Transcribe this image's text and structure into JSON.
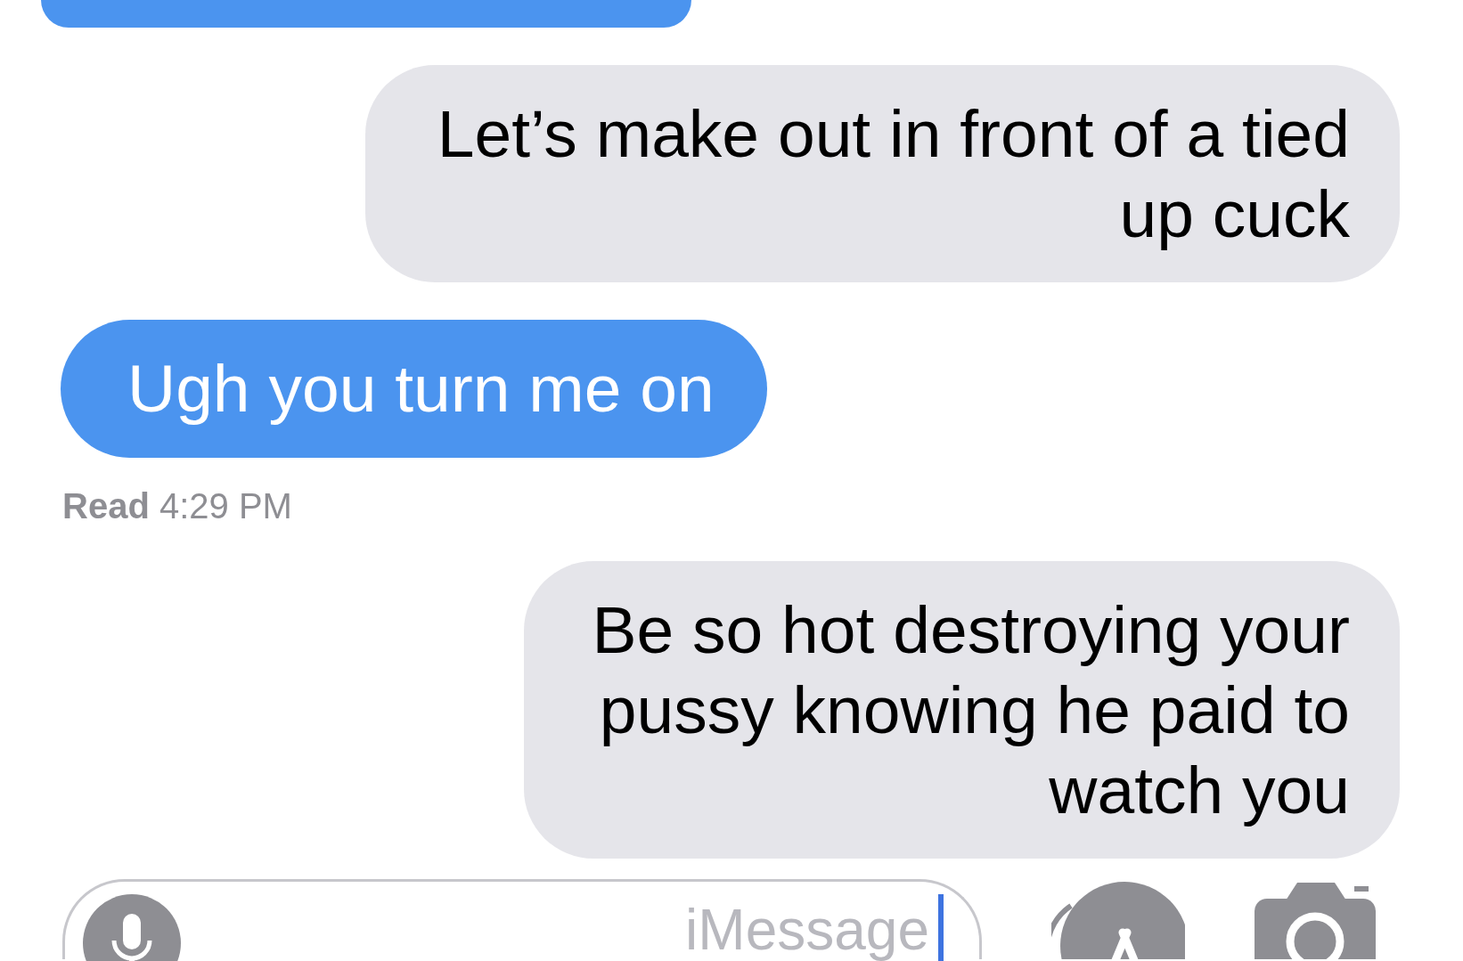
{
  "messages": [
    {
      "kind": "sent"
    },
    {
      "kind": "received",
      "text": "Let’s make out in front of a tied up cuck"
    },
    {
      "kind": "sent",
      "text": "Ugh you turn me on",
      "receipt": {
        "label": "Read",
        "time": "4:29 PM"
      }
    },
    {
      "kind": "received",
      "text": "Be so hot destroying your pussy knowing he paid to watch you"
    }
  ],
  "compose": {
    "placeholder": "iMessage"
  }
}
